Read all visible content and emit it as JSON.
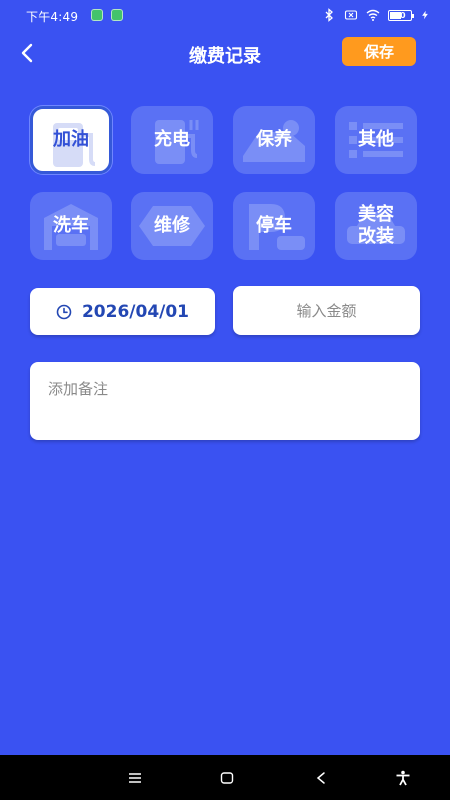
{
  "status_bar": {
    "time": "下午4:49",
    "battery": "50"
  },
  "header": {
    "title": "缴费记录",
    "save_label": "保存"
  },
  "categories": [
    {
      "label": "加油",
      "icon": "fuel-pump-icon",
      "selected": true
    },
    {
      "label": "充电",
      "icon": "charging-station-icon",
      "selected": false
    },
    {
      "label": "保养",
      "icon": "maintenance-oil-icon",
      "selected": false
    },
    {
      "label": "其他",
      "icon": "list-icon",
      "selected": false
    },
    {
      "label": "洗车",
      "icon": "car-wash-icon",
      "selected": false
    },
    {
      "label": "维修",
      "icon": "repair-wrench-icon",
      "selected": false
    },
    {
      "label": "停车",
      "icon": "parking-icon",
      "selected": false
    },
    {
      "label": "美容改装",
      "icon": "car-modification-icon",
      "selected": false
    }
  ],
  "form": {
    "date": "2026/04/01",
    "amount_placeholder": "输入金额",
    "note_placeholder": "添加备注"
  },
  "colors": {
    "background": "#3a52f2",
    "accent": "#ff9a1e",
    "tile": "#5a71f4",
    "date_text": "#2347b3"
  }
}
